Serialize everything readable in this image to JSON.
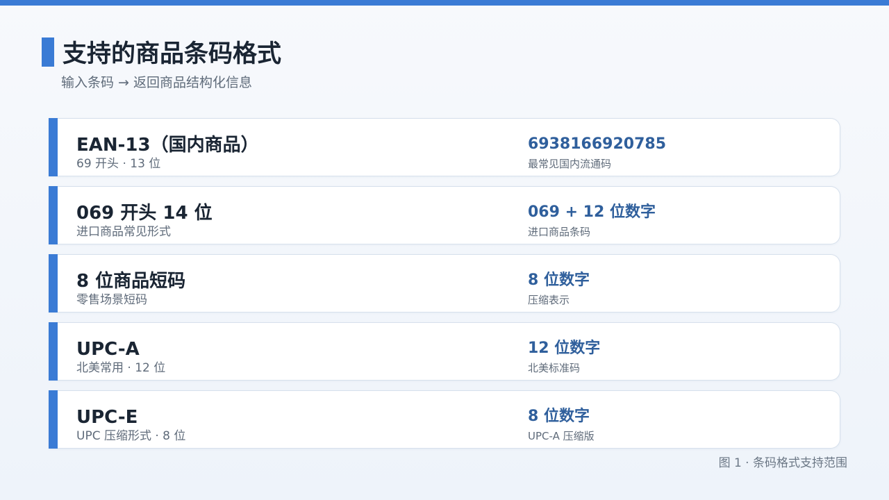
{
  "header": {
    "title": "支持的商品条码格式",
    "subtitle": "输入条码 → 返回商品结构化信息"
  },
  "formats": [
    {
      "name": "EAN-13（国内商品）",
      "desc": "69 开头 · 13 位",
      "value": "6938166920785",
      "note": "最常见国内流通码"
    },
    {
      "name": "069 开头 14 位",
      "desc": "进口商品常见形式",
      "value": "069 + 12 位数字",
      "note": "进口商品条码"
    },
    {
      "name": "8 位商品短码",
      "desc": "零售场景短码",
      "value": "8 位数字",
      "note": "压缩表示"
    },
    {
      "name": "UPC-A",
      "desc": "北美常用 · 12 位",
      "value": "12 位数字",
      "note": "北美标准码"
    },
    {
      "name": "UPC-E",
      "desc": "UPC 压缩形式 · 8 位",
      "value": "8 位数字",
      "note": "UPC-A 压缩版"
    }
  ],
  "caption": "图 1 · 条码格式支持范围",
  "colors": {
    "accent": "#3a7bd5",
    "value_text": "#2f5f9c",
    "title_text": "#1a2533"
  }
}
